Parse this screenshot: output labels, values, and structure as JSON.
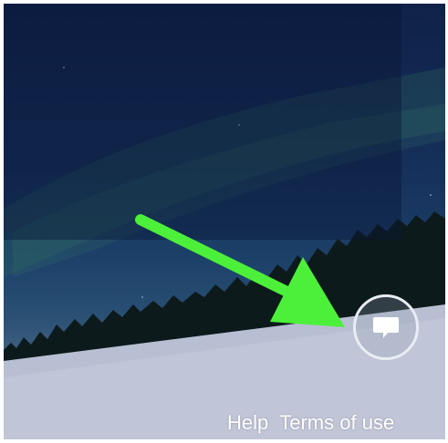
{
  "footer": {
    "help_label": "Help",
    "terms_label": "Terms of use"
  },
  "feedback_button": {
    "icon": "speech-bubble-icon"
  },
  "annotation": {
    "icon": "arrow-icon",
    "color": "#4cf03a"
  },
  "colors": {
    "sky_top": "#0f2148",
    "snow": "#b8bfd2",
    "link_text": "#ffffff"
  }
}
